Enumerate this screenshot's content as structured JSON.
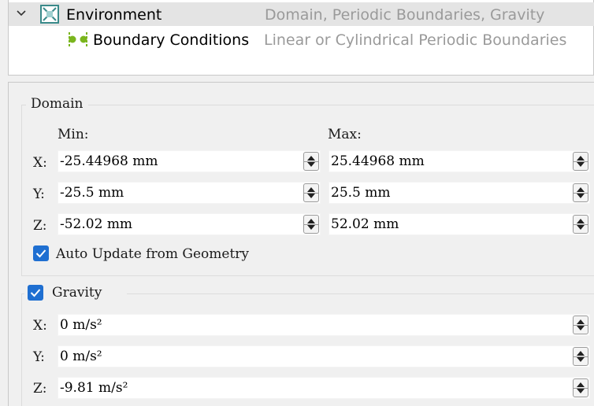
{
  "tree": {
    "environment": {
      "name": "Environment",
      "desc": "Domain, Periodic Boundaries, Gravity"
    },
    "boundary": {
      "name": "Boundary Conditions",
      "desc": "Linear or Cylindrical Periodic Boundaries"
    }
  },
  "domain": {
    "title": "Domain",
    "min_header": "Min:",
    "max_header": "Max:",
    "rows": [
      {
        "axis": "X:",
        "min": "-25.44968 mm",
        "max": "25.44968 mm"
      },
      {
        "axis": "Y:",
        "min": "-25.5 mm",
        "max": "25.5 mm"
      },
      {
        "axis": "Z:",
        "min": "-52.02 mm",
        "max": "52.02 mm"
      }
    ],
    "auto_update": {
      "label": "Auto Update from Geometry",
      "checked": true
    }
  },
  "gravity": {
    "title": "Gravity",
    "checked": true,
    "rows": [
      {
        "axis": "X:",
        "value": "0 m/s²"
      },
      {
        "axis": "Y:",
        "value": "0 m/s²"
      },
      {
        "axis": "Z:",
        "value": "-9.81 m/s²"
      }
    ]
  },
  "colors": {
    "accent": "#1f6fd1",
    "selection": "#e4e4e4",
    "desc_text": "#9a9a9a",
    "node_icon": "#3a8a8a",
    "bc_icon": "#7ab51d"
  }
}
